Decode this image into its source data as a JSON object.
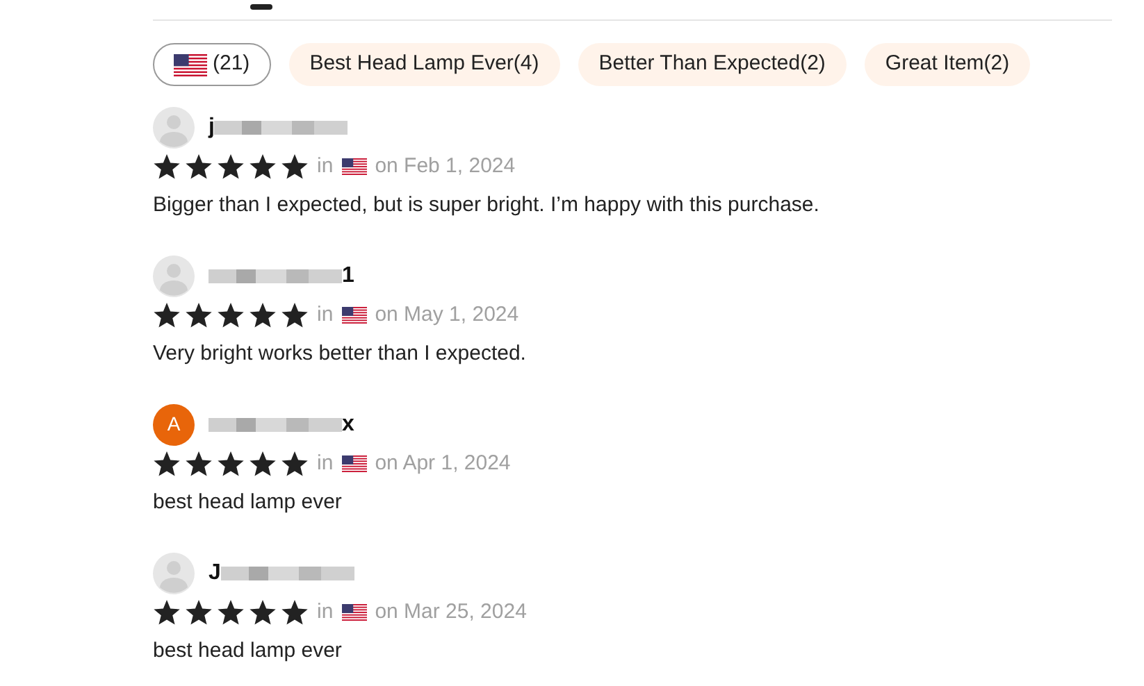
{
  "tab_indicator": {
    "selected": true
  },
  "filters": [
    {
      "kind": "country",
      "label": "(21)",
      "selected": true
    },
    {
      "kind": "tag",
      "label": "Best Head Lamp Ever(4)",
      "selected": false
    },
    {
      "kind": "tag",
      "label": "Better Than Expected(2)",
      "selected": false
    },
    {
      "kind": "tag",
      "label": "Great Item(2)",
      "selected": false
    }
  ],
  "reviews": [
    {
      "avatar": {
        "kind": "placeholder"
      },
      "name_parts": [
        {
          "kind": "text",
          "text": "j"
        },
        {
          "kind": "blur"
        }
      ],
      "stars": 5,
      "in": "in",
      "date": "on Feb 1, 2024",
      "text": "Bigger than I expected, but is super bright. I’m happy with this purchase."
    },
    {
      "avatar": {
        "kind": "placeholder"
      },
      "name_parts": [
        {
          "kind": "blur"
        },
        {
          "kind": "text",
          "text": "1"
        }
      ],
      "stars": 5,
      "in": "in",
      "date": "on May 1, 2024",
      "text": "Very bright works better than I expected."
    },
    {
      "avatar": {
        "kind": "initial",
        "letter": "A",
        "color": "#e8650a"
      },
      "name_parts": [
        {
          "kind": "blur"
        },
        {
          "kind": "text",
          "text": "x"
        }
      ],
      "stars": 5,
      "in": "in",
      "date": "on Apr 1, 2024",
      "text": "best head lamp ever"
    },
    {
      "avatar": {
        "kind": "placeholder"
      },
      "name_parts": [
        {
          "kind": "text",
          "text": "J"
        },
        {
          "kind": "blur"
        }
      ],
      "stars": 5,
      "in": "in",
      "date": "on Mar 25, 2024",
      "text": "best head lamp ever"
    }
  ]
}
